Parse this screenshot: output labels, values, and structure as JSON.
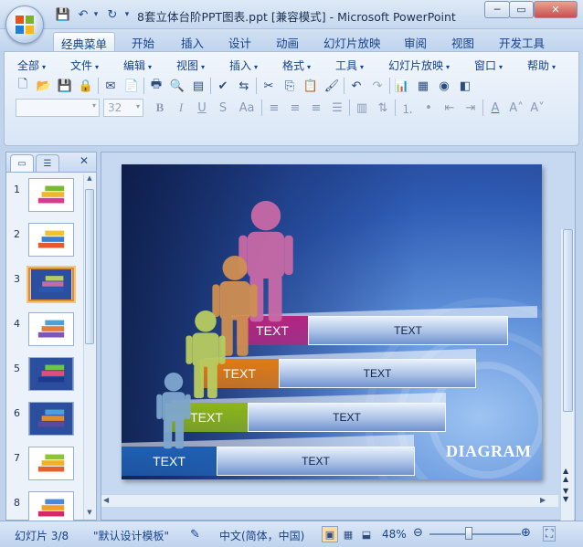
{
  "window": {
    "title": "8套立体台阶PPT图表.ppt [兼容模式] - Microsoft PowerPoint",
    "minimize": "─",
    "restore": "▭",
    "close": "✕"
  },
  "qat": {
    "save": "💾",
    "undo": "↶",
    "redo": "↻",
    "dropdown": "▾"
  },
  "tabs": [
    "经典菜单",
    "开始",
    "插入",
    "设计",
    "动画",
    "幻灯片放映",
    "审阅",
    "视图",
    "开发工具"
  ],
  "menu": [
    "全部",
    "文件",
    "编辑",
    "视图",
    "插入",
    "格式",
    "工具",
    "幻灯片放映",
    "窗口",
    "帮助"
  ],
  "format_bar": {
    "font_name": "",
    "font_size": "32",
    "bold": "B",
    "italic": "I",
    "underline": "U",
    "shadow": "S",
    "case": "Aa"
  },
  "slide_panel": {
    "slides": [
      "1",
      "2",
      "3",
      "4",
      "5",
      "6",
      "7",
      "8"
    ],
    "selected": 3,
    "close": "✕"
  },
  "slide": {
    "stairs": [
      {
        "label": "TEXT",
        "text": "TEXT",
        "color": "#b6247f"
      },
      {
        "label": "TEXT",
        "text": "TEXT",
        "color": "#e27a12"
      },
      {
        "label": "TEXT",
        "text": "TEXT",
        "color": "#8db616"
      },
      {
        "label": "TEXT",
        "text": "TEXT",
        "color": "#1f5fb2"
      }
    ],
    "title": "DIAGRAM",
    "figure_colors": [
      "#c86aa7",
      "#cf8f52",
      "#b8cc61",
      "#7fa7cf"
    ]
  },
  "status": {
    "slide_info": "幻灯片 3/8",
    "template": "\"默认设计模板\"",
    "language": "中文(简体，中国)",
    "zoom": "48%",
    "zoom_value": 48
  }
}
